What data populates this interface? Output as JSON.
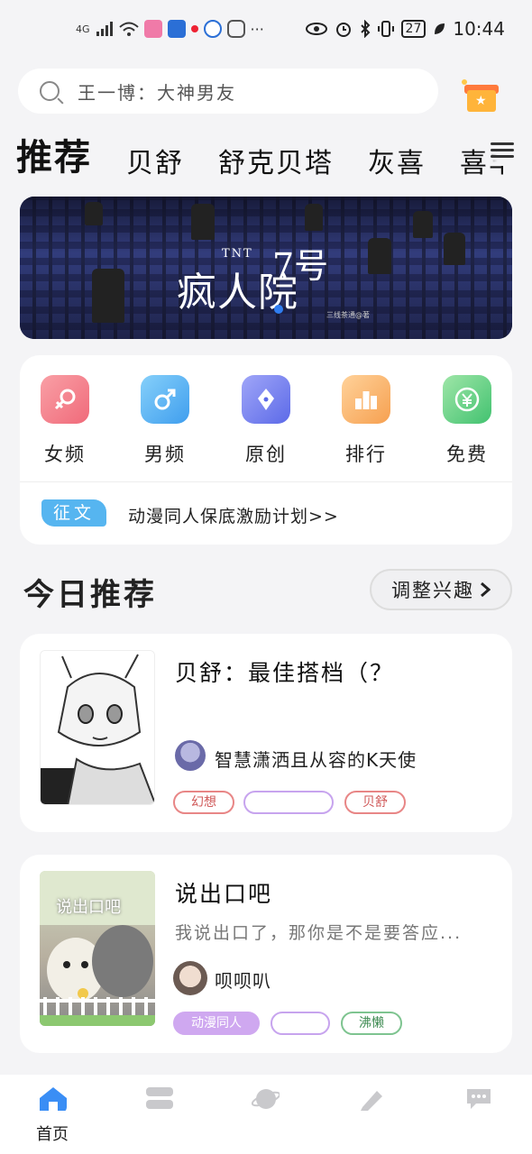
{
  "status_bar": {
    "network": "4G",
    "time": "10:44",
    "battery": "27"
  },
  "search": {
    "placeholder": "王一博：大神男友"
  },
  "tabs": [
    "推荐",
    "贝舒",
    "舒克贝塔",
    "灰喜",
    "喜羊羊"
  ],
  "banner": {
    "title_en": "TNT",
    "title_cn": "疯人院",
    "title_num": "7号",
    "credit": "三线茶通@著"
  },
  "categories": [
    {
      "label": "女频",
      "icon": "female-icon",
      "color": "#f47a8a"
    },
    {
      "label": "男频",
      "icon": "male-icon",
      "color": "#5aaef0"
    },
    {
      "label": "原创",
      "icon": "pen-nib-icon",
      "color": "#7a86f0"
    },
    {
      "label": "排行",
      "icon": "podium-icon",
      "color": "#f6b46c"
    },
    {
      "label": "免费",
      "icon": "yen-icon",
      "color": "#6cd08a"
    }
  ],
  "notice": {
    "tag": "征文",
    "text": "动漫同人保底激励计划>>"
  },
  "section": {
    "title": "今日推荐",
    "adjust_label": "调整兴趣"
  },
  "books": [
    {
      "title": "贝舒：最佳搭档（？",
      "author": "智慧潇洒且从容的K天使",
      "tags": [
        "幻想",
        "",
        "贝舒"
      ]
    },
    {
      "title": "说出口吧",
      "desc": "我说出口了，那你是不是要答应...",
      "author": "呗呗叭",
      "cover_text": "说出口吧",
      "tags": [
        "动漫同人",
        "",
        "沸懒"
      ]
    }
  ],
  "tabbar": [
    {
      "label": "首页",
      "icon": "home-icon",
      "active": true
    },
    {
      "label": "",
      "icon": "bookshelf-icon"
    },
    {
      "label": "",
      "icon": "planet-icon"
    },
    {
      "label": "",
      "icon": "pencil-icon"
    },
    {
      "label": "",
      "icon": "chat-icon"
    }
  ]
}
